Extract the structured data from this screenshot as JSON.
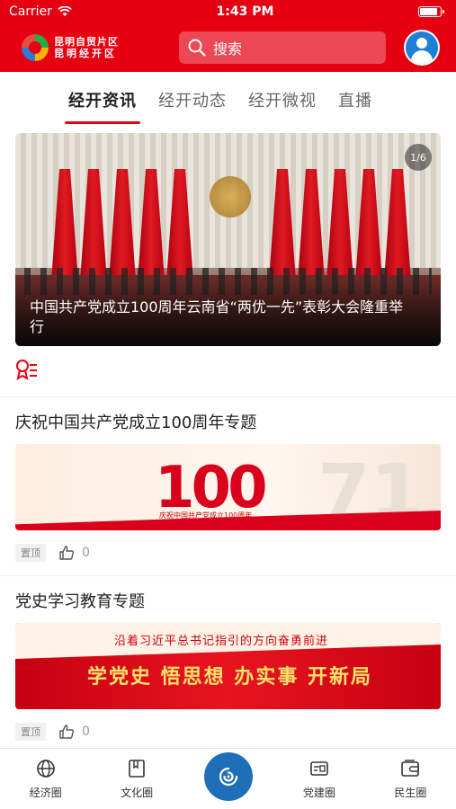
{
  "status_bar": {
    "carrier": "Carrier",
    "time": "1:43 PM",
    "battery_level": 0.9
  },
  "header": {
    "logo_line1": "昆明自贸片区",
    "logo_line2": "昆明经开区",
    "search_placeholder": "搜索"
  },
  "tabs": [
    {
      "label": "经开资讯",
      "active": true
    },
    {
      "label": "经开动态",
      "active": false
    },
    {
      "label": "经开微视",
      "active": false
    },
    {
      "label": "直播",
      "active": false
    }
  ],
  "banner": {
    "caption": "中国共产党成立100周年云南省“两优一先”表彰大会隆重举行",
    "counter": "1/6"
  },
  "articles": [
    {
      "title": "庆祝中国共产党成立100周年专题",
      "image_text_main": "100",
      "image_text_sub": "庆祝中国共产党成立100周年",
      "image_text_big": "71",
      "tag": "置顶",
      "likes": "0"
    },
    {
      "title": "党史学习教育专题",
      "image_text_slogan1": "沿着习近平总书记指引的方向奋勇前进",
      "image_text_slogan2": "学党史 悟思想 办实事 开新局",
      "tag": "置顶",
      "likes": "0"
    }
  ],
  "tabbar": [
    {
      "label": "经济圈",
      "icon": "globe-icon"
    },
    {
      "label": "文化圈",
      "icon": "book-icon"
    },
    {
      "label": "",
      "icon": "swirl-logo-icon"
    },
    {
      "label": "党建圈",
      "icon": "id-card-icon"
    },
    {
      "label": "民生圈",
      "icon": "wallet-icon"
    }
  ],
  "colors": {
    "brand_red": "#e50012",
    "center_blue": "#1e6fb8"
  }
}
